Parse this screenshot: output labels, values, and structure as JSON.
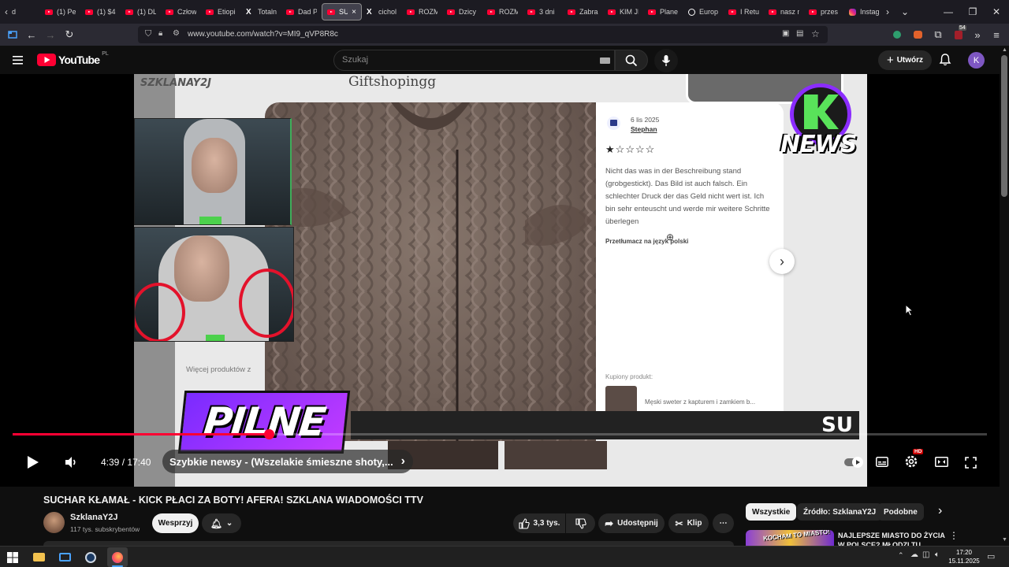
{
  "browser": {
    "tabs": [
      {
        "label": "d",
        "icon": "back-icon"
      },
      {
        "label": "(1) Pe",
        "icon": "youtube-icon"
      },
      {
        "label": "(1) $4",
        "icon": "youtube-icon"
      },
      {
        "label": "(1) DL",
        "icon": "youtube-icon"
      },
      {
        "label": "Człow",
        "icon": "youtube-icon"
      },
      {
        "label": "Etiopi",
        "icon": "youtube-icon"
      },
      {
        "label": "Totaln",
        "icon": "x-icon"
      },
      {
        "label": "Dad P",
        "icon": "youtube-icon"
      },
      {
        "label": "SUC",
        "icon": "youtube-icon",
        "active": true
      },
      {
        "label": "cichol",
        "icon": "x-icon"
      },
      {
        "label": "ROZM",
        "icon": "youtube-icon"
      },
      {
        "label": "Dzicy",
        "icon": "youtube-icon"
      },
      {
        "label": "ROZM",
        "icon": "youtube-icon"
      },
      {
        "label": "3 dni",
        "icon": "youtube-icon"
      },
      {
        "label": "Zabra",
        "icon": "youtube-icon"
      },
      {
        "label": "KIM JI",
        "icon": "youtube-icon"
      },
      {
        "label": "Plane",
        "icon": "youtube-icon"
      },
      {
        "label": "Europ",
        "icon": "globe-icon"
      },
      {
        "label": "I Retu",
        "icon": "youtube-icon"
      },
      {
        "label": "nasz n",
        "icon": "youtube-icon"
      },
      {
        "label": "przes",
        "icon": "youtube-icon"
      },
      {
        "label": "Instag",
        "icon": "instagram-icon"
      }
    ],
    "tab_close": "×",
    "url": "www.youtube.com/watch?v=MI9_qVP8R8c",
    "ext_badge": "54"
  },
  "youtube": {
    "logo_text": "YouTube",
    "logo_region": "PL",
    "search_placeholder": "Szukaj",
    "create_label": "Utwórz",
    "avatar_letter": "K"
  },
  "video": {
    "overlay": {
      "channel_watermark": "SZKLANAY2J",
      "shop_title": "Giftshopingg",
      "review_date": "6 lis 2025",
      "reviewer": "Stephan",
      "rating": 1,
      "rating_max": 5,
      "review_text": "Nicht das was in der Beschreibung stand (grobgestickt). Das Bild ist auch falsch. Ein schlechter Druck der das Geld nicht wert ist. Ich bin sehr enteuscht und werde mir weitere Schritte überlegen",
      "translate_link": "Przetłumacz na język polski",
      "purchased_label": "Kupiony produkt:",
      "purchased_item": "Męski sweter z kapturem i zamkiem b...",
      "more_products": "Więcej produktów z",
      "news_logo_text": "NEWS",
      "pilne_text": "PILNE",
      "ticker_text": "SU"
    },
    "time_current": "4:39",
    "time_separator": "/",
    "time_total": "17:40",
    "progress_fraction": 0.2632,
    "chapter_title": "Szybkie newsy - (Wszelakie śmieszne shoty,...",
    "settings_badge": "HD"
  },
  "details": {
    "title": "SUCHAR KŁAMAŁ - KICK PŁACI ZA BOTY! AFERA! SZKLANA WIADOMOŚCI TTV",
    "channel_name": "SzklanaY2J",
    "subscribers": "117 tys. subskrybentów",
    "support_label": "Wesprzyj",
    "likes": "3,3 tys.",
    "share_label": "Udostępnij",
    "clip_label": "Klip",
    "more": "⋯"
  },
  "chips": [
    "Wszystkie",
    "Źródło: SzklanaY2J",
    "Podobne"
  ],
  "recommended": {
    "thumb_text": "KOCHAM TO MIASTO!",
    "title": "NAJLEPSZE MIASTO DO ŻYCIA W POLSCE? MŁODZI TU"
  },
  "taskbar": {
    "time": "17:20",
    "date": "15.11.2025"
  }
}
